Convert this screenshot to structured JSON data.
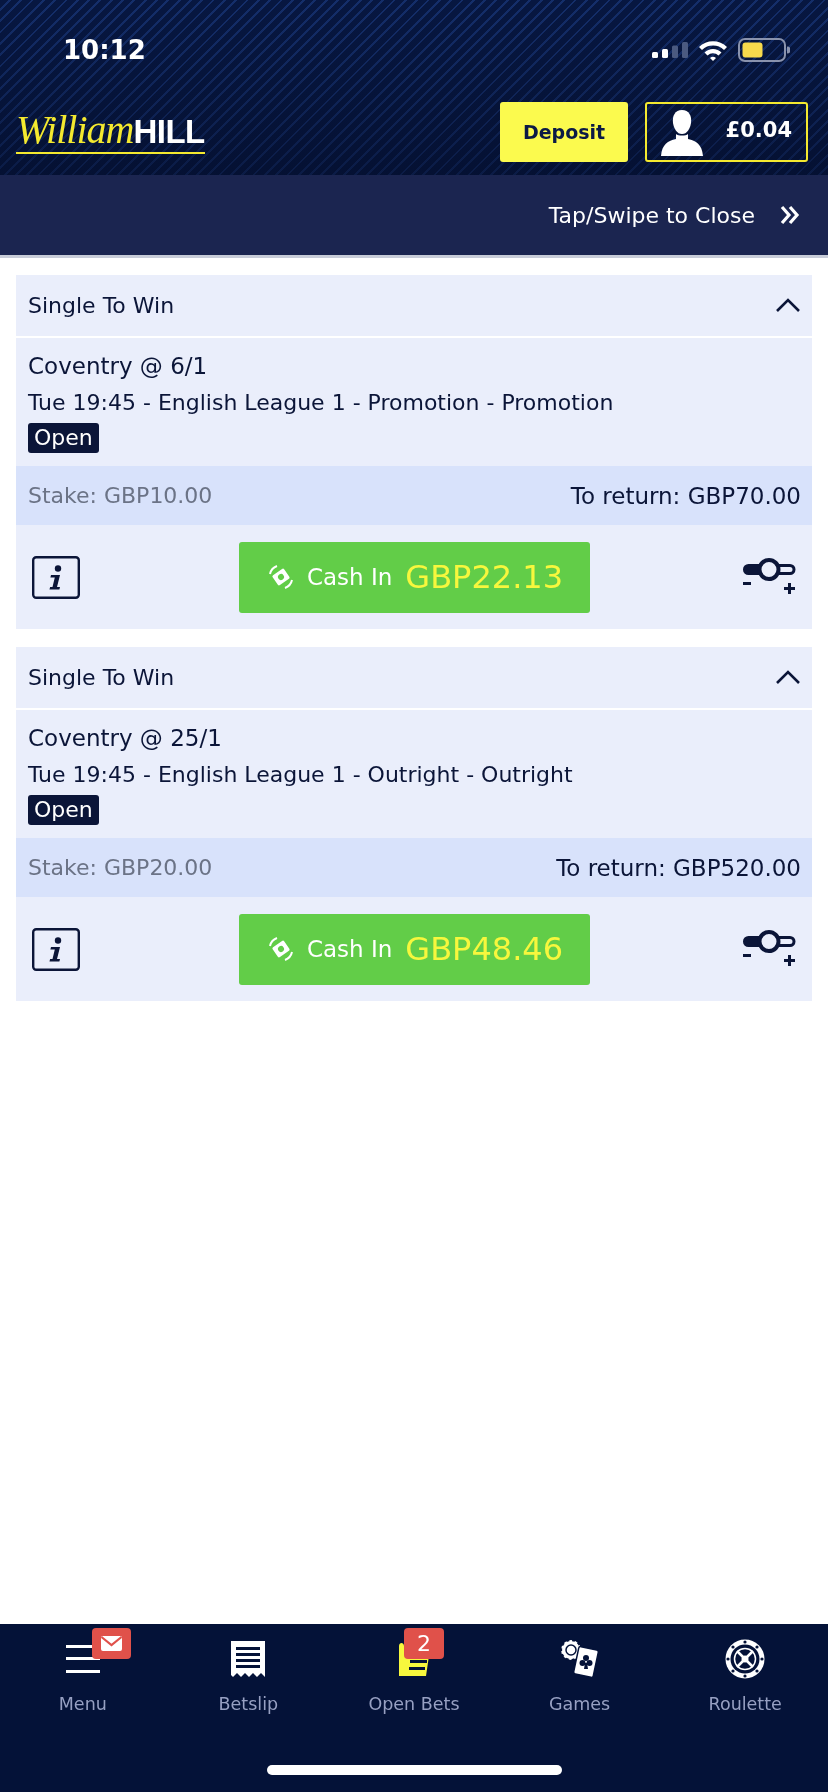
{
  "status_bar": {
    "time": "10:12"
  },
  "header": {
    "logo": {
      "script": "William",
      "bold": "HILL"
    },
    "deposit_button": "Deposit",
    "balance": "£0.04"
  },
  "close_bar": {
    "label": "Tap/Swipe to Close"
  },
  "bets": [
    {
      "type": "Single To Win",
      "expanded": true,
      "selection": "Coventry @ 6/1",
      "event": "Tue 19:45 - English League 1 - Promotion - Promotion",
      "status": "Open",
      "stake": "Stake: GBP10.00",
      "to_return": "To return: GBP70.00",
      "cash_in": {
        "label": "Cash In",
        "amount": "GBP22.13"
      }
    },
    {
      "type": "Single To Win",
      "expanded": true,
      "selection": "Coventry @ 25/1",
      "event": "Tue 19:45 - English League 1 - Outright - Outright",
      "status": "Open",
      "stake": "Stake: GBP20.00",
      "to_return": "To return: GBP520.00",
      "cash_in": {
        "label": "Cash In",
        "amount": "GBP48.46"
      }
    }
  ],
  "bottom_nav": {
    "items": [
      {
        "kind": "menu",
        "label": "Menu",
        "selected": false,
        "badge": {
          "kind": "mail"
        }
      },
      {
        "kind": "betslip",
        "label": "Betslip",
        "selected": false
      },
      {
        "kind": "open-bets",
        "label": "Open Bets",
        "selected": true,
        "badge": {
          "kind": "count",
          "text": "2"
        }
      },
      {
        "kind": "games",
        "label": "Games",
        "selected": false
      },
      {
        "kind": "roulette",
        "label": "Roulette",
        "selected": false
      }
    ]
  }
}
